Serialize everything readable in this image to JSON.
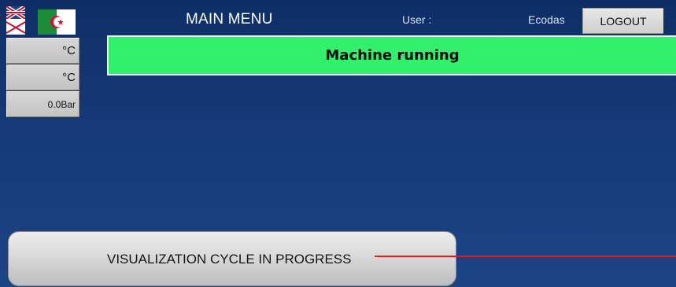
{
  "header": {
    "title": "MAIN MENU",
    "user_label": "User :",
    "user_name": "Ecodas",
    "logout_label": "LOGOUT",
    "flags": [
      {
        "icon": "uk-flag-icon"
      },
      {
        "icon": "algeria-flag-icon"
      }
    ]
  },
  "readouts": [
    {
      "value": "°C"
    },
    {
      "value": "°C"
    },
    {
      "value": "0.0Bar"
    }
  ],
  "status": {
    "message": "Machine running",
    "color": "#33f06c"
  },
  "cycle": {
    "label": "VISUALIZATION CYCLE IN PROGRESS",
    "line_color": "#e51b24"
  },
  "colors": {
    "background": "#163a78"
  }
}
